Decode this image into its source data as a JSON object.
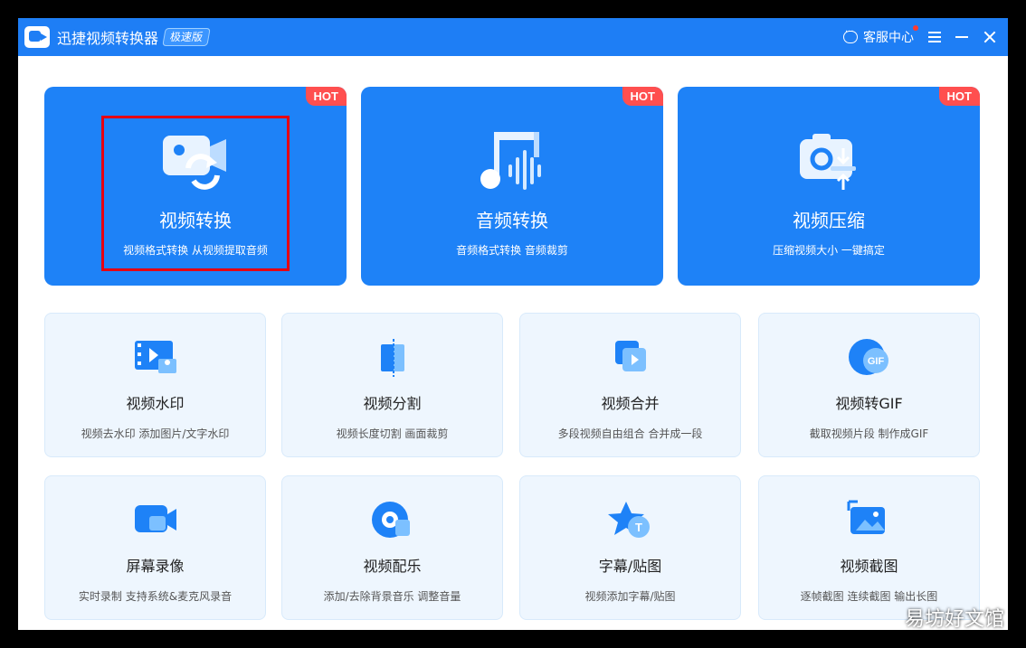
{
  "titlebar": {
    "app_name": "迅捷视频转换器",
    "edition_badge": "极速版",
    "support_label": "客服中心"
  },
  "feature_cards": [
    {
      "title": "视频转换",
      "subtitle": "视频格式转换 从视频提取音频",
      "hot": "HOT"
    },
    {
      "title": "音频转换",
      "subtitle": "音频格式转换 音频裁剪",
      "hot": "HOT"
    },
    {
      "title": "视频压缩",
      "subtitle": "压缩视频大小 一键搞定",
      "hot": "HOT"
    }
  ],
  "tool_cards": [
    {
      "title": "视频水印",
      "subtitle": "视频去水印 添加图片/文字水印"
    },
    {
      "title": "视频分割",
      "subtitle": "视频长度切割 画面裁剪"
    },
    {
      "title": "视频合并",
      "subtitle": "多段视频自由组合 合并成一段"
    },
    {
      "title": "视频转GIF",
      "subtitle": "截取视频片段 制作成GIF",
      "icon_text": "GIF"
    },
    {
      "title": "屏幕录像",
      "subtitle": "实时录制 支持系统&麦克风录音"
    },
    {
      "title": "视频配乐",
      "subtitle": "添加/去除背景音乐 调整音量"
    },
    {
      "title": "字幕/贴图",
      "subtitle": "视频添加字幕/贴图",
      "icon_text": "T"
    },
    {
      "title": "视频截图",
      "subtitle": "逐帧截图 连续截图 输出长图"
    }
  ],
  "watermark": "易坊好文馆",
  "colors": {
    "primary": "#1e82f7",
    "hot": "#ff4f4f",
    "highlight": "#e60012",
    "card_bg": "#eef6fe"
  }
}
